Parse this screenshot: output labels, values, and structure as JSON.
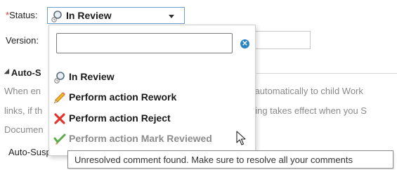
{
  "form": {
    "status_label": "Status:",
    "required_marker": "*",
    "status_value": "In Review",
    "version_label": "Version:",
    "section_title": "Auto-S",
    "bg_line1_left": "When en",
    "bg_line1_right": "l automatically to child Work",
    "bg_line2_left": "links, if th",
    "bg_line2_right": "tting takes effect when you S",
    "bg_line3_left": "Documen",
    "bg_line4_left": "Auto-Suspe"
  },
  "dropdown": {
    "search_value": "",
    "clear_icon": "x-circle-icon",
    "items": [
      {
        "label": "In Review",
        "icon": "review-status-icon",
        "enabled": true
      },
      {
        "label": "Perform action Rework",
        "icon": "pencil-icon",
        "enabled": true
      },
      {
        "label": "Perform action Reject",
        "icon": "red-x-icon",
        "enabled": true
      },
      {
        "label": "Perform action Mark Reviewed",
        "icon": "mark-reviewed-icon",
        "enabled": false
      }
    ]
  },
  "tooltip": {
    "text": "Unresolved comment found. Make sure to resolve all your comments"
  },
  "colors": {
    "required": "#e23b2e",
    "select_border": "#6b9fd0",
    "clear_button": "#2c86c4",
    "reject_red": "#e0352b",
    "disabled_text": "#8c8c8c"
  }
}
